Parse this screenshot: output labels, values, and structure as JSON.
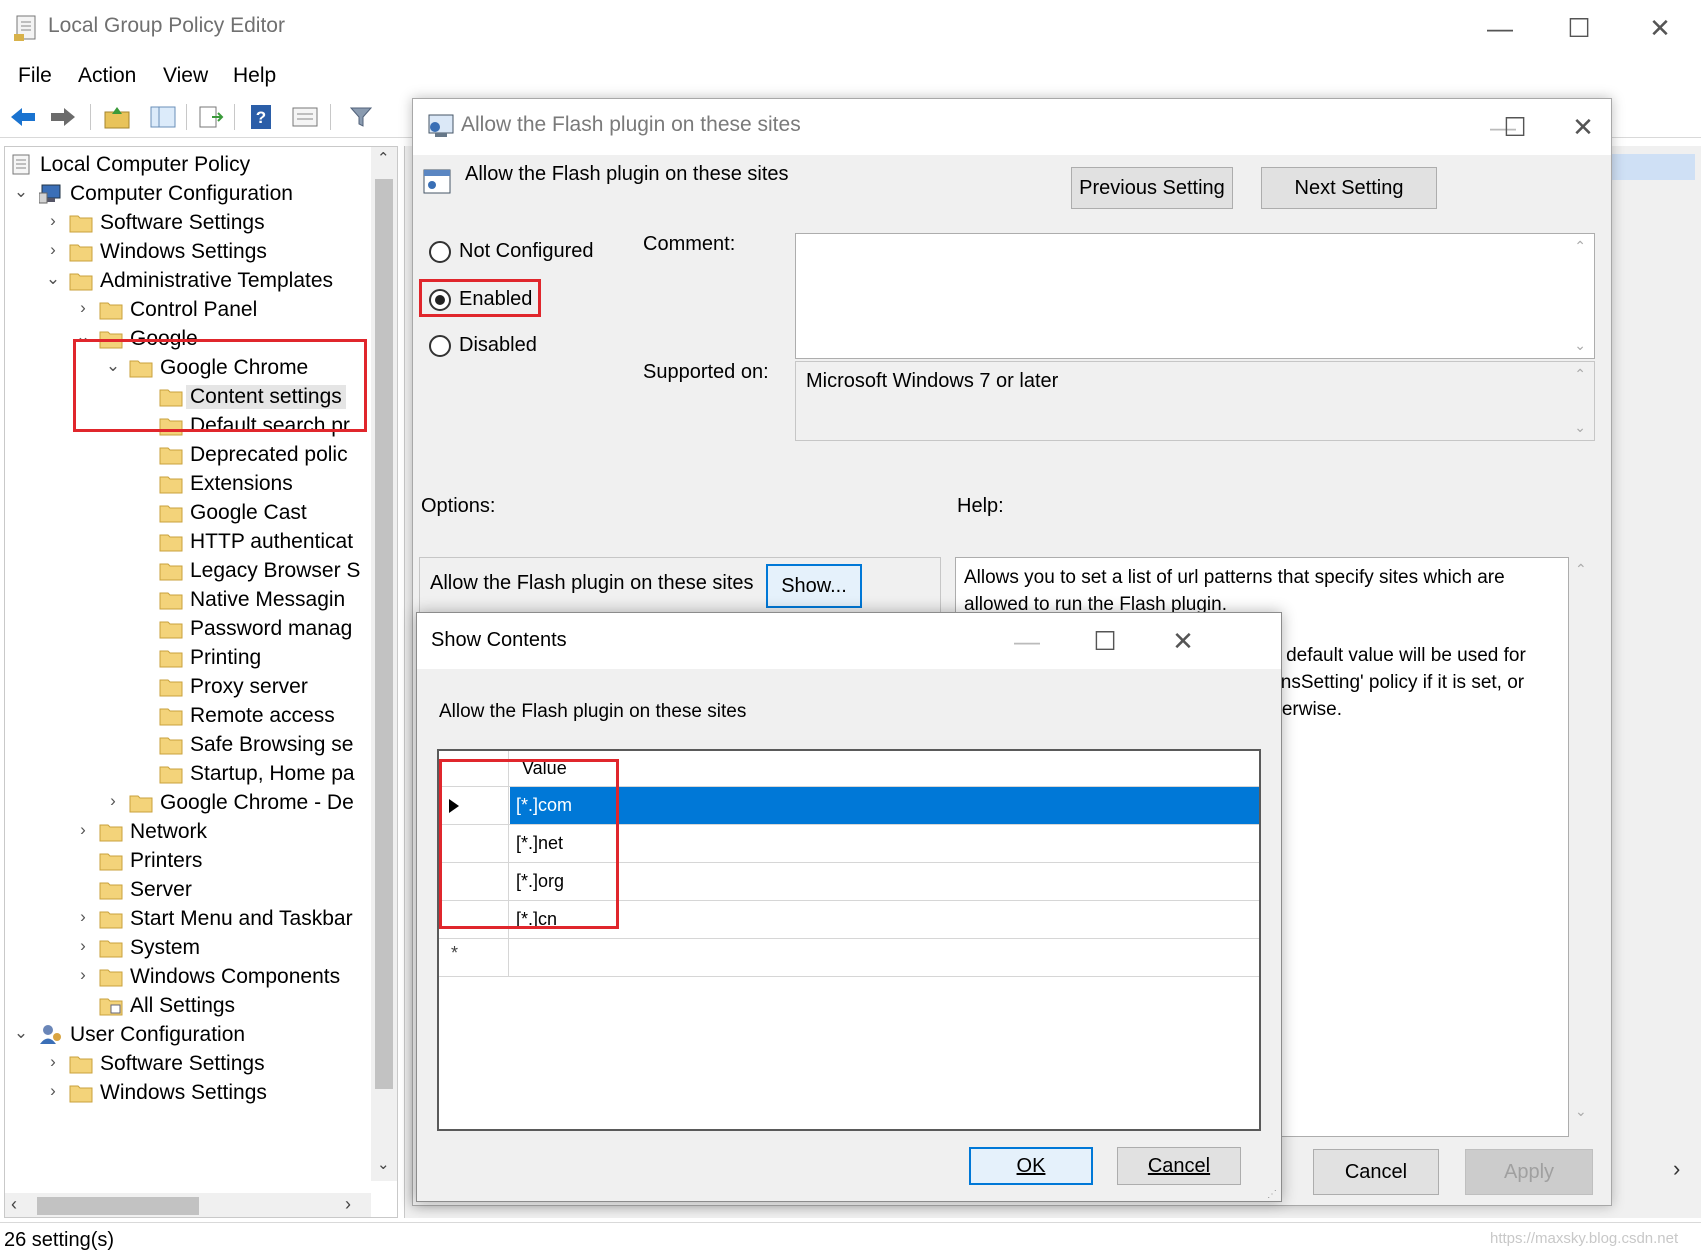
{
  "window": {
    "title": "Local Group Policy Editor",
    "minimize": "—",
    "maximize": "☐",
    "close": "✕"
  },
  "menu": [
    "File",
    "Action",
    "View",
    "Help"
  ],
  "tree": {
    "rows": [
      {
        "label": "Local Computer Policy",
        "level": 0,
        "exp": "",
        "icon": "policy-icon"
      },
      {
        "label": "Computer Configuration",
        "level": 0,
        "exp": "⌄",
        "icon": "computer-icon"
      },
      {
        "label": "Software Settings",
        "level": 1,
        "exp": "›",
        "icon": "folder-icon"
      },
      {
        "label": "Windows Settings",
        "level": 1,
        "exp": "›",
        "icon": "folder-icon"
      },
      {
        "label": "Administrative Templates",
        "level": 1,
        "exp": "⌄",
        "icon": "folder-icon"
      },
      {
        "label": "Control Panel",
        "level": 2,
        "exp": "›",
        "icon": "folder-icon"
      },
      {
        "label": "Google",
        "level": 2,
        "exp": "⌄",
        "icon": "folder-icon"
      },
      {
        "label": "Google Chrome",
        "level": 3,
        "exp": "⌄",
        "icon": "folder-icon"
      },
      {
        "label": "Content settings",
        "level": 4,
        "exp": "",
        "icon": "folder-icon",
        "selected": true
      },
      {
        "label": "Default search pr",
        "level": 4,
        "exp": "",
        "icon": "folder-icon"
      },
      {
        "label": "Deprecated polic",
        "level": 4,
        "exp": "",
        "icon": "folder-icon"
      },
      {
        "label": "Extensions",
        "level": 4,
        "exp": "",
        "icon": "folder-icon"
      },
      {
        "label": "Google Cast",
        "level": 4,
        "exp": "",
        "icon": "folder-icon"
      },
      {
        "label": "HTTP authenticat",
        "level": 4,
        "exp": "",
        "icon": "folder-icon"
      },
      {
        "label": "Legacy Browser S",
        "level": 4,
        "exp": "",
        "icon": "folder-icon"
      },
      {
        "label": "Native Messagin",
        "level": 4,
        "exp": "",
        "icon": "folder-icon"
      },
      {
        "label": "Password manag",
        "level": 4,
        "exp": "",
        "icon": "folder-icon"
      },
      {
        "label": "Printing",
        "level": 4,
        "exp": "",
        "icon": "folder-icon"
      },
      {
        "label": "Proxy server",
        "level": 4,
        "exp": "",
        "icon": "folder-icon"
      },
      {
        "label": "Remote access",
        "level": 4,
        "exp": "",
        "icon": "folder-icon"
      },
      {
        "label": "Safe Browsing se",
        "level": 4,
        "exp": "",
        "icon": "folder-icon"
      },
      {
        "label": "Startup, Home pa",
        "level": 4,
        "exp": "",
        "icon": "folder-icon"
      },
      {
        "label": "Google Chrome - De",
        "level": 3,
        "exp": "›",
        "icon": "folder-icon"
      },
      {
        "label": "Network",
        "level": 2,
        "exp": "›",
        "icon": "folder-icon"
      },
      {
        "label": "Printers",
        "level": 2,
        "exp": "",
        "icon": "folder-icon"
      },
      {
        "label": "Server",
        "level": 2,
        "exp": "",
        "icon": "folder-icon"
      },
      {
        "label": "Start Menu and Taskbar",
        "level": 2,
        "exp": "›",
        "icon": "folder-icon"
      },
      {
        "label": "System",
        "level": 2,
        "exp": "›",
        "icon": "folder-icon"
      },
      {
        "label": "Windows Components",
        "level": 2,
        "exp": "›",
        "icon": "folder-icon"
      },
      {
        "label": "All Settings",
        "level": 2,
        "exp": "",
        "icon": "settings-folder-icon"
      },
      {
        "label": "User Configuration",
        "level": 0,
        "exp": "⌄",
        "icon": "user-icon"
      },
      {
        "label": "Software Settings",
        "level": 1,
        "exp": "›",
        "icon": "folder-icon"
      },
      {
        "label": "Windows Settings",
        "level": 1,
        "exp": "›",
        "icon": "folder-icon"
      }
    ]
  },
  "status": "26 setting(s)",
  "policy_dialog": {
    "title": "Allow the Flash plugin on these sites",
    "heading": "Allow the Flash plugin on these sites",
    "previous": "Previous Setting",
    "next": "Next Setting",
    "radio_not_configured": "Not Configured",
    "radio_enabled": "Enabled",
    "radio_disabled": "Disabled",
    "comment_label": "Comment:",
    "supported_label": "Supported on:",
    "supported_value": "Microsoft Windows 7 or later",
    "options_label": "Options:",
    "help_label": "Help:",
    "option_text": "Allow the Flash plugin on these sites",
    "show_button": "Show...",
    "help_line1": "Allows you to set a list of url patterns that specify sites which are",
    "help_line2": "allowed to run the Flash plugin.",
    "help_line3": "al default value will be used for",
    "help_line4": "ginsSetting' policy if it is set, or",
    "help_line5": "therwise.",
    "cancel": "Cancel",
    "apply": "Apply"
  },
  "show_dialog": {
    "title": "Show Contents",
    "caption": "Allow the Flash plugin on these sites",
    "column": "Value",
    "rows": [
      "[*.]com",
      "[*.]net",
      "[*.]org",
      "[*.]cn"
    ],
    "new_row_marker": "*",
    "ok": "OK",
    "cancel": "Cancel"
  },
  "watermark": "https://maxsky.blog.csdn.net",
  "colors": {
    "selection": "#0078d7",
    "highlight_box": "#e0262c"
  }
}
